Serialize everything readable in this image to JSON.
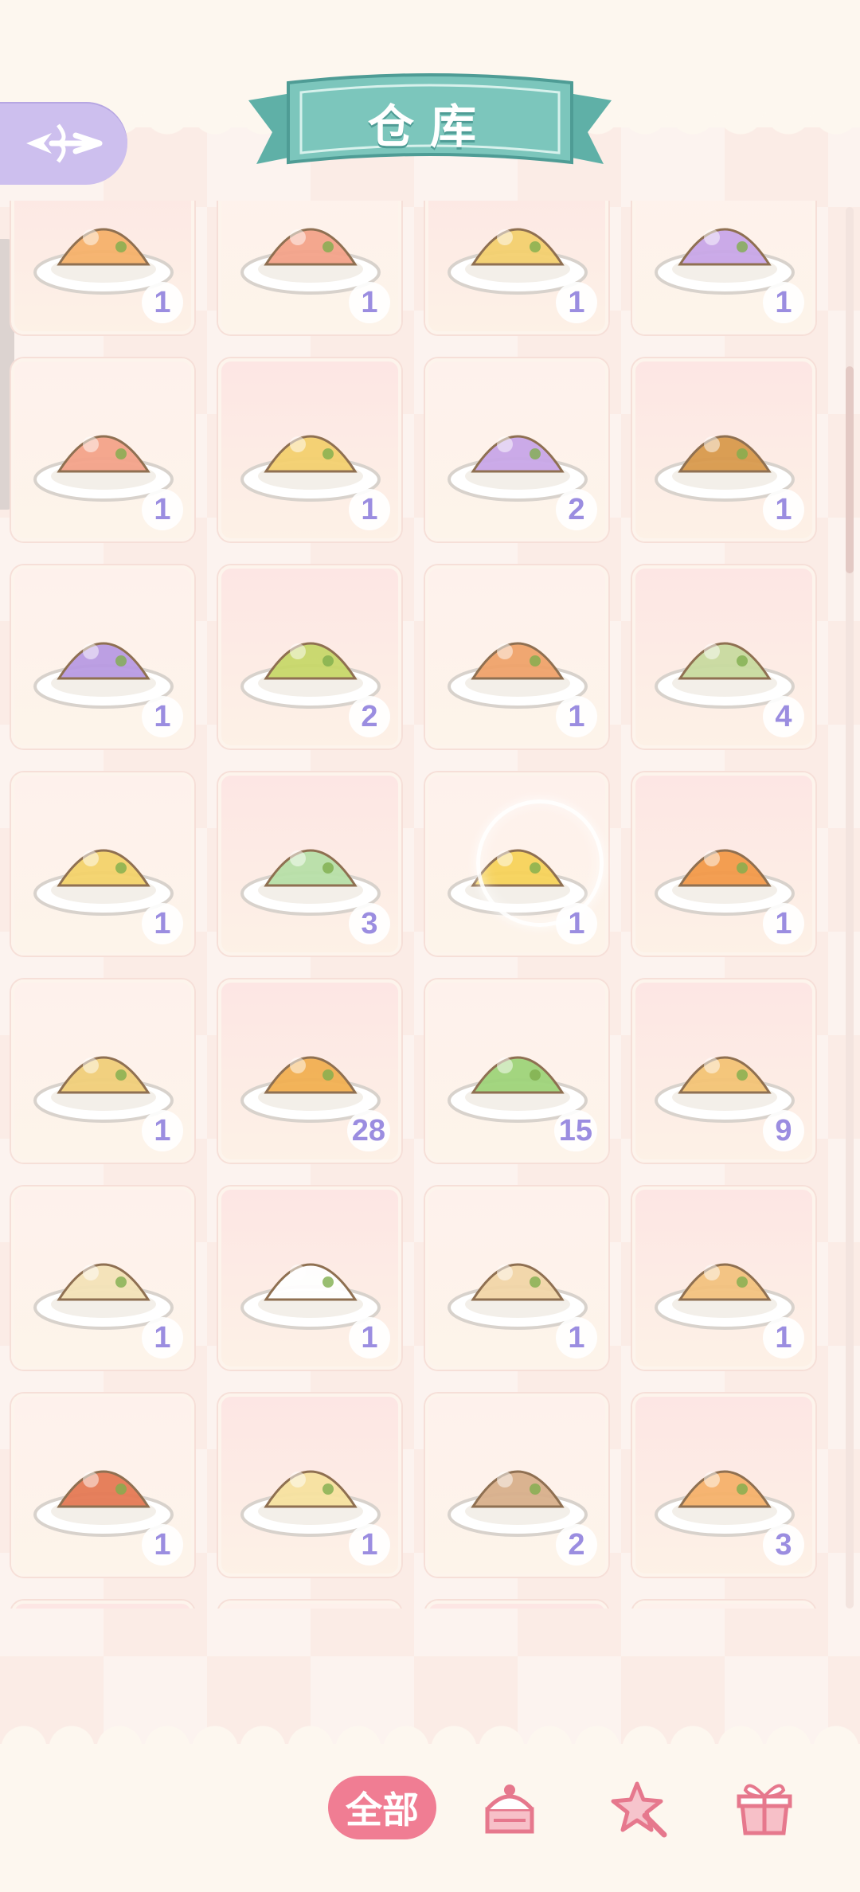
{
  "header": {
    "title": "仓库",
    "back_icon": "winged-arrow-icon"
  },
  "inventory": {
    "partial_top_row": [
      {
        "name": "food-item",
        "icon": "dish-icon",
        "count": "1"
      },
      {
        "name": "food-item",
        "icon": "dish-icon",
        "count": "1"
      },
      {
        "name": "food-item",
        "icon": "dish-icon",
        "count": "1"
      },
      {
        "name": "food-item",
        "icon": "dish-icon",
        "count": "1"
      }
    ],
    "items": [
      {
        "icon": "tea-cup-icon",
        "count": "1"
      },
      {
        "icon": "salmon-cake-icon",
        "count": "1"
      },
      {
        "icon": "egg-bowl-icon",
        "count": "2"
      },
      {
        "icon": "purple-pudding-icon",
        "count": "1"
      },
      {
        "icon": "roast-chicken-icon",
        "count": "1"
      },
      {
        "icon": "purple-taro-icon",
        "count": "2"
      },
      {
        "icon": "stuffed-peppers-icon",
        "count": "1"
      },
      {
        "icon": "shrimp-platter-icon",
        "count": "4"
      },
      {
        "icon": "matcha-parfait-icon",
        "count": "1"
      },
      {
        "icon": "eggs-benedict-icon",
        "count": "3"
      },
      {
        "icon": "matcha-mousse-icon",
        "count": "1"
      },
      {
        "icon": "omelette-box-icon",
        "count": "1"
      },
      {
        "icon": "burger-box-icon",
        "count": "1"
      },
      {
        "icon": "tamagoyaki-icon",
        "count": "28"
      },
      {
        "icon": "pizza-slice-icon",
        "count": "15"
      },
      {
        "icon": "veggie-wrap-icon",
        "count": "9"
      },
      {
        "icon": "bread-roll-icon",
        "count": "1"
      },
      {
        "icon": "mushroom-soup-icon",
        "count": "1"
      },
      {
        "icon": "soft-serve-icon",
        "count": "1"
      },
      {
        "icon": "toast-pasta-icon",
        "count": "1"
      },
      {
        "icon": "cream-bun-icon",
        "count": "1"
      },
      {
        "icon": "pizza-gratin-icon",
        "count": "1"
      },
      {
        "icon": "egg-crepe-icon",
        "count": "2"
      },
      {
        "icon": "chocolate-jar-icon",
        "count": "3"
      }
    ],
    "partial_bottom_row": [
      {
        "icon": "cherry-cake-icon"
      },
      {
        "icon": "meat-skewer-icon"
      },
      {
        "icon": "sandwich-icon"
      },
      {
        "icon": "fish-roll-icon"
      }
    ]
  },
  "tabs": {
    "all_label": "全部",
    "cake_icon": "cake-icon",
    "magic_icon": "magic-wand-icon",
    "gift_icon": "gift-box-icon"
  }
}
